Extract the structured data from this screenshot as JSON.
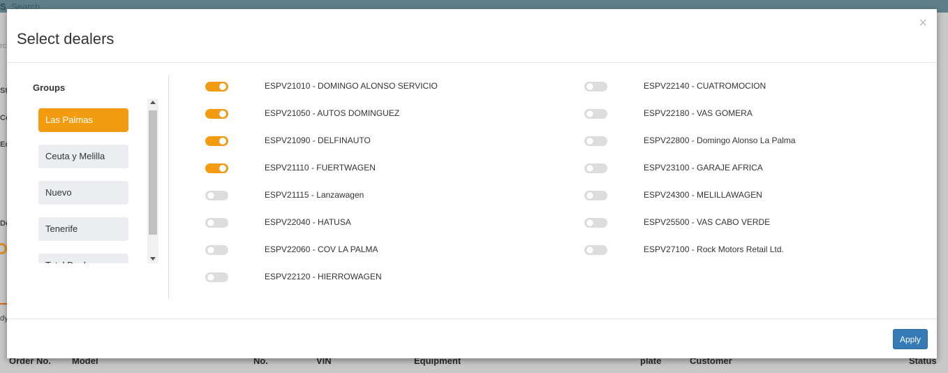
{
  "background": {
    "app_short": "S",
    "search_label": "Search",
    "left_fragments": [
      "rc",
      "Sta",
      "Co",
      "Eq",
      "De",
      "dy"
    ],
    "table_headers": [
      "Order No.",
      "Model",
      "No.",
      "VIN",
      "Equipment",
      "plate",
      "Customer",
      "Status"
    ]
  },
  "modal": {
    "title": "Select dealers",
    "close_symbol": "×",
    "groups_title": "Groups",
    "groups": [
      {
        "label": "Las Palmas",
        "active": true
      },
      {
        "label": "Ceuta y Melilla",
        "active": false
      },
      {
        "label": "Nuevo",
        "active": false
      },
      {
        "label": "Tenerife",
        "active": false
      },
      {
        "label": "Total Dealers",
        "active": false
      }
    ],
    "dealers_left": [
      {
        "label": "ESPV21010 - DOMINGO ALONSO SERVICIO",
        "on": true
      },
      {
        "label": "ESPV21050 - AUTOS DOMINGUEZ",
        "on": true
      },
      {
        "label": "ESPV21090 - DELFINAUTO",
        "on": true
      },
      {
        "label": "ESPV21110 - FUERTWAGEN",
        "on": true
      },
      {
        "label": "ESPV21115 - Lanzawagen",
        "on": false
      },
      {
        "label": "ESPV22040 - HATUSA",
        "on": false
      },
      {
        "label": "ESPV22060 - COV LA PALMA",
        "on": false
      },
      {
        "label": "ESPV22120 - HIERROWAGEN",
        "on": false
      }
    ],
    "dealers_right": [
      {
        "label": "ESPV22140 - CUATROMOCION",
        "on": false
      },
      {
        "label": "ESPV22180 - VAS GOMERA",
        "on": false
      },
      {
        "label": "ESPV22800 - Domingo Alonso La Palma",
        "on": false
      },
      {
        "label": "ESPV23100 - GARAJE AFRICA",
        "on": false
      },
      {
        "label": "ESPV24300 - MELILLAWAGEN",
        "on": false
      },
      {
        "label": "ESPV25500 - VAS CABO VERDE",
        "on": false
      },
      {
        "label": "ESPV27100 - Rock Motors Retail Ltd.",
        "on": false
      }
    ],
    "apply_label": "Apply"
  },
  "colors": {
    "accent": "#f39c12",
    "primary": "#337ab7"
  }
}
